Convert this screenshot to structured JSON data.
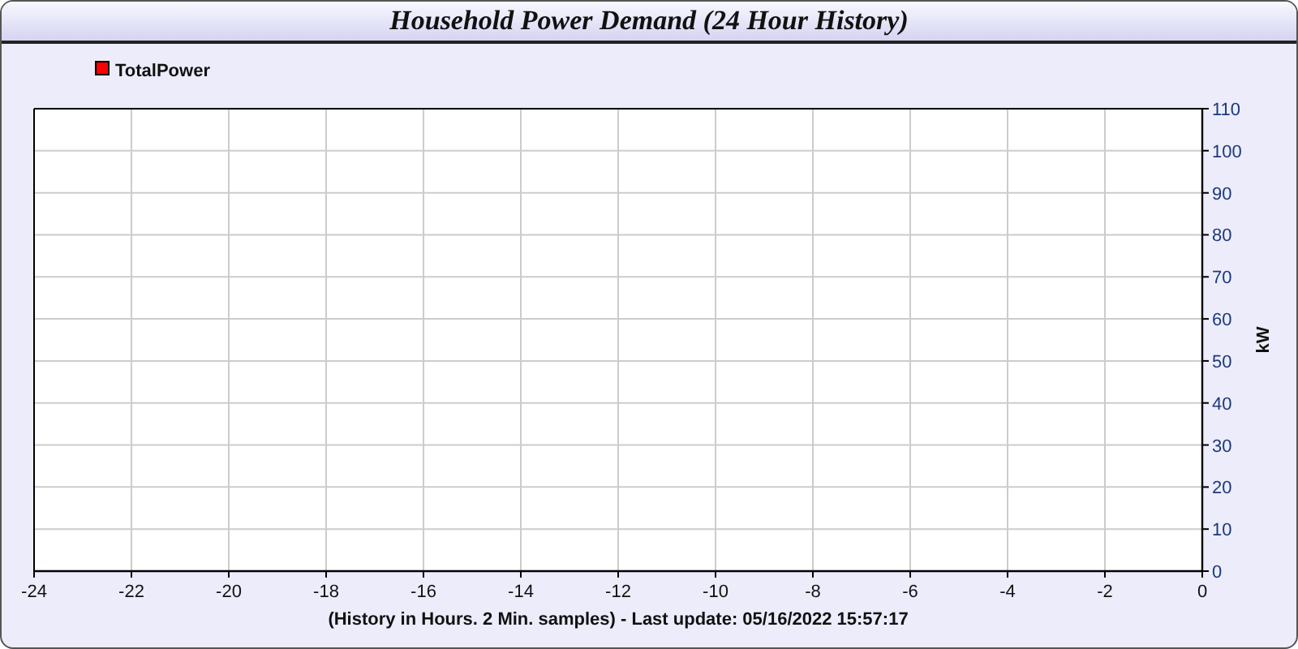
{
  "window": {
    "title": "Household Power Demand (24 Hour History)"
  },
  "chart": {
    "chart_data": {
      "type": "line",
      "xlabel": "(History in Hours. 2 Min. samples) - Last update: 05/16/2022 15:57:17",
      "ylabel": "kW",
      "ylim": [
        0,
        110
      ],
      "grid": true,
      "categories": [
        "-24",
        "-22",
        "-20",
        "-18",
        "-16",
        "-14",
        "-12",
        "-10",
        "-8",
        "-6",
        "-4",
        "-2",
        "0"
      ],
      "yticks": [
        0,
        10,
        20,
        30,
        40,
        50,
        60,
        70,
        80,
        90,
        100,
        110
      ],
      "series": [
        {
          "name": "TotalPower",
          "color": "#ff0000",
          "values": [
            null,
            null,
            null,
            null,
            null,
            null,
            null,
            null,
            null,
            null,
            null,
            null,
            null
          ]
        }
      ]
    }
  }
}
